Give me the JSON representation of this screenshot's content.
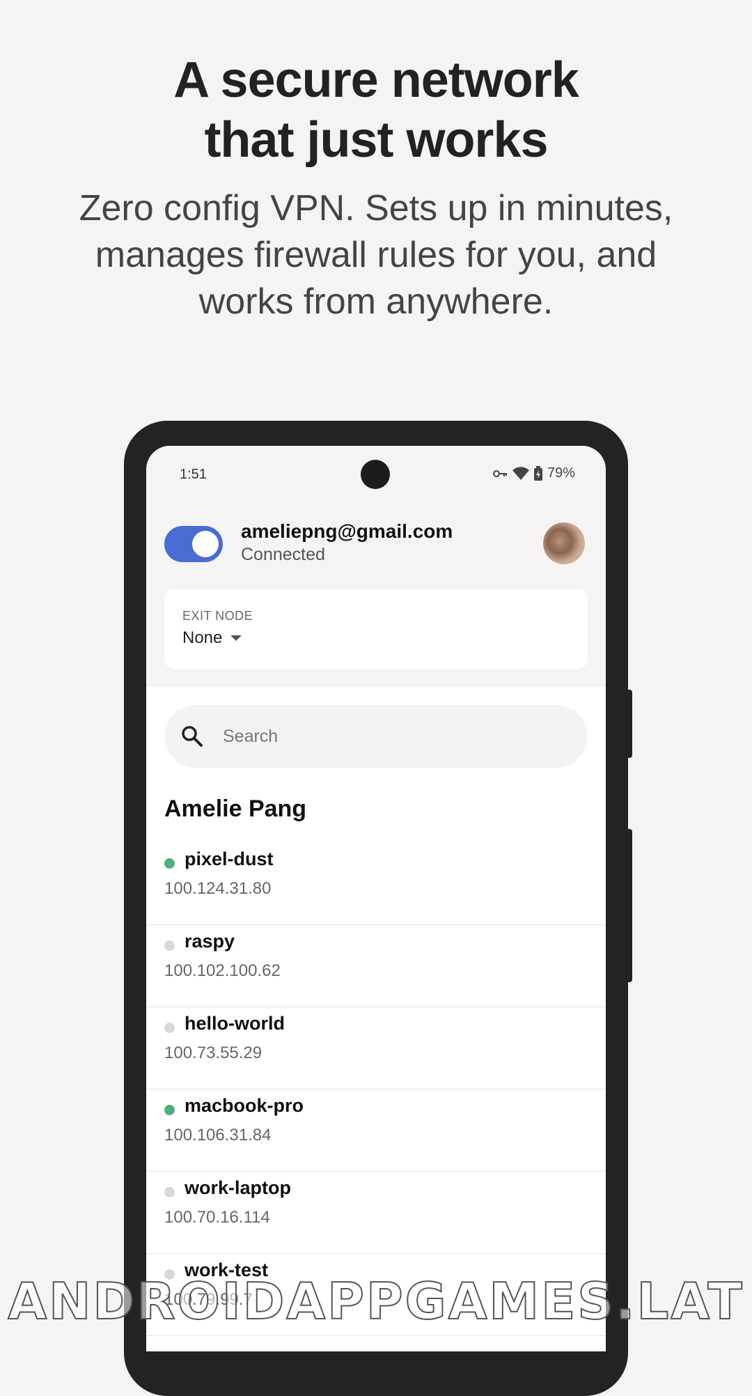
{
  "hero": {
    "title_line1": "A secure network",
    "title_line2": "that just works",
    "subtitle_line1": "Zero config VPN. Sets up in minutes,",
    "subtitle_line2": "manages firewall rules for you, and",
    "subtitle_line3": "works from anywhere."
  },
  "status_bar": {
    "time": "1:51",
    "battery": "79%",
    "icons": [
      "vpn-key-icon",
      "wifi-icon",
      "battery-charging-icon"
    ]
  },
  "account": {
    "vpn_enabled": true,
    "email": "ameliepng@gmail.com",
    "status": "Connected"
  },
  "exit_node": {
    "label": "EXIT NODE",
    "value": "None"
  },
  "search": {
    "placeholder": "Search",
    "value": ""
  },
  "devices_section": {
    "owner": "Amelie Pang",
    "devices": [
      {
        "name": "pixel-dust",
        "ip": "100.124.31.80",
        "online": true
      },
      {
        "name": "raspy",
        "ip": "100.102.100.62",
        "online": false
      },
      {
        "name": "hello-world",
        "ip": "100.73.55.29",
        "online": false
      },
      {
        "name": "macbook-pro",
        "ip": "100.106.31.84",
        "online": true
      },
      {
        "name": "work-laptop",
        "ip": "100.70.16.114",
        "online": false
      },
      {
        "name": "work-test",
        "ip": "100.79.99.7",
        "online": false
      }
    ]
  },
  "colors": {
    "online": "#4caf7d",
    "offline": "#d8d8d8",
    "toggle_on": "#4a6ad4"
  },
  "watermark": "ANDROIDAPPGAMES.LAT"
}
